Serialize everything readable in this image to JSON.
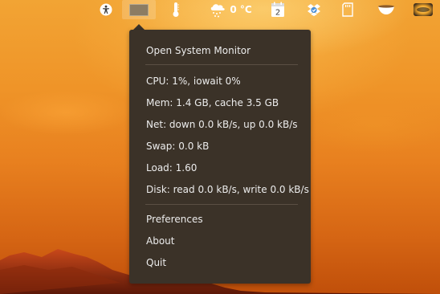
{
  "panel": {
    "weather_temp": "0 °C",
    "calendar_day": "2",
    "icons": [
      "accessibility-icon",
      "system-monitor-icon",
      "thermometer-icon",
      "weather-snow-icon",
      "calendar-icon",
      "dropbox-icon",
      "sd-card-icon",
      "tea-cup-icon",
      "session-icon"
    ]
  },
  "menu": {
    "open_monitor": "Open System Monitor",
    "stats": {
      "cpu": "CPU: 1%, iowait 0%",
      "mem": "Mem: 1.4 GB, cache 3.5 GB",
      "net": "Net: down 0.0 kB/s, up 0.0 kB/s",
      "swap": "Swap: 0.0 kB",
      "load": "Load: 1.60",
      "disk": "Disk: read 0.0 kB/s, write 0.0 kB/s"
    },
    "preferences": "Preferences",
    "about": "About",
    "quit": "Quit"
  },
  "colors": {
    "menu_background": "#3b3228",
    "menu_text": "#ececec",
    "wallpaper_accent": "#ef9428"
  }
}
